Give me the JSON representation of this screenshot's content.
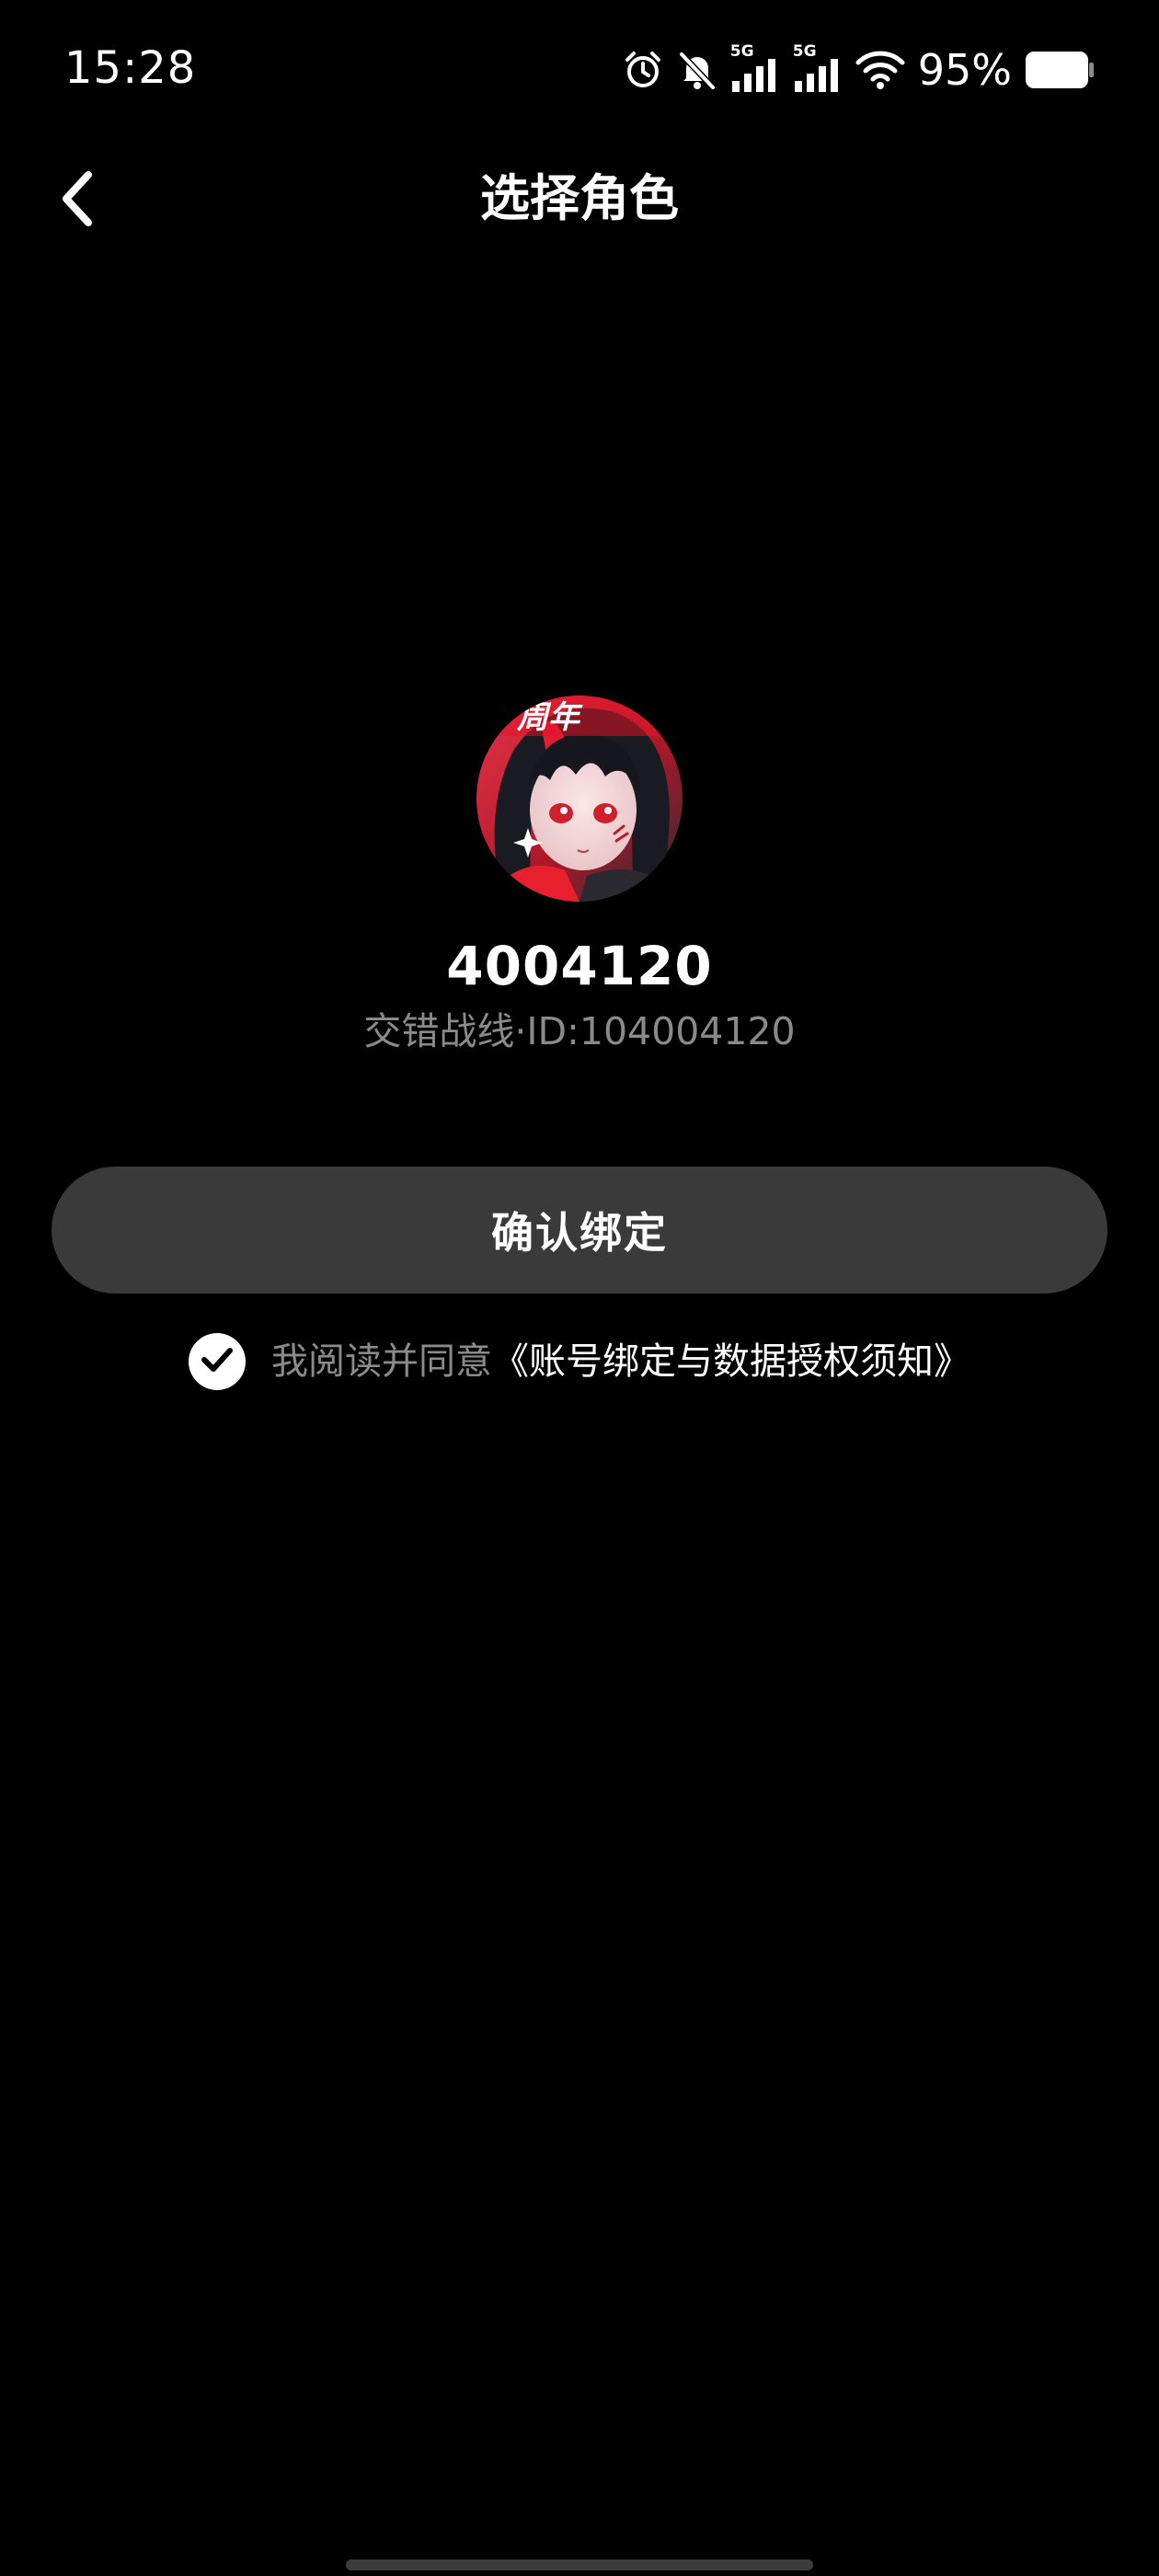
{
  "status_bar": {
    "time": "15:28",
    "network_1": "5G",
    "network_2": "5G",
    "battery_percent": "95%",
    "battery_level": 0.95,
    "icons": [
      "alarm-icon",
      "mute-bell-icon",
      "signal-5g-icon",
      "signal-5g-icon",
      "wifi-icon",
      "battery-icon"
    ]
  },
  "header": {
    "title": "选择角色",
    "back_icon": "chevron-left-icon"
  },
  "profile": {
    "name": "4004120",
    "game": "交错战线",
    "separator": "·",
    "id_label": "ID:",
    "id_value": "104004120",
    "meta": "交错战线·ID:104004120",
    "avatar_banner_text": "周年"
  },
  "actions": {
    "confirm_label": "确认绑定"
  },
  "agreement": {
    "checked": true,
    "text": "我阅读并同意",
    "link": "《账号绑定与数据授权须知》"
  },
  "colors": {
    "background": "#000000",
    "button_bg": "#3a3a3a",
    "muted_text": "#8a8a8a",
    "primary_text": "#ffffff"
  }
}
